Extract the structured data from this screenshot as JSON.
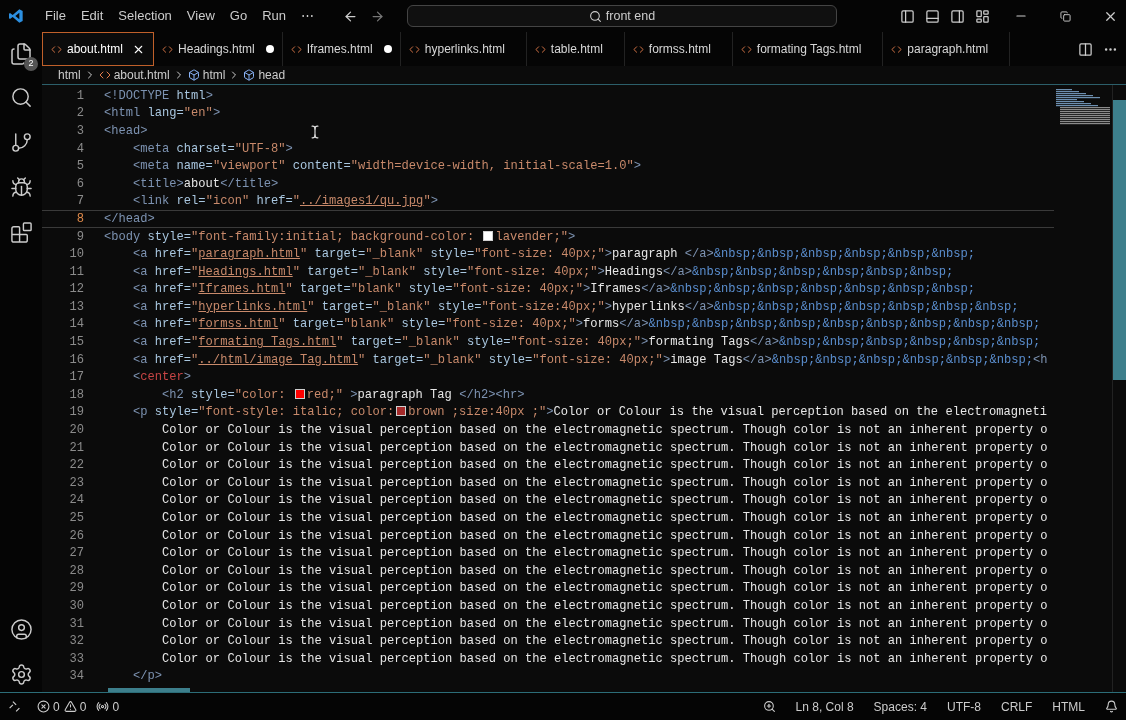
{
  "menu": [
    "File",
    "Edit",
    "Selection",
    "View",
    "Go",
    "Run",
    "⋯"
  ],
  "search": {
    "value": "front end"
  },
  "activity": {
    "explorer_badge": "2"
  },
  "tabs": [
    {
      "label": "about.html",
      "selected": true,
      "modified": false
    },
    {
      "label": "Headings.html",
      "selected": false,
      "modified": true
    },
    {
      "label": "Iframes.html",
      "selected": false,
      "modified": true
    },
    {
      "label": "hyperlinks.html",
      "selected": false,
      "modified": false
    },
    {
      "label": "table.html",
      "selected": false,
      "modified": false
    },
    {
      "label": "formss.html",
      "selected": false,
      "modified": false
    },
    {
      "label": "formating Tags.html",
      "selected": false,
      "modified": false
    },
    {
      "label": "paragraph.html",
      "selected": false,
      "modified": false
    }
  ],
  "breadcrumb": [
    {
      "label": "html",
      "kind": "folder"
    },
    {
      "label": "about.html",
      "kind": "file"
    },
    {
      "label": "html",
      "kind": "element"
    },
    {
      "label": "head",
      "kind": "element"
    }
  ],
  "lines": [
    {
      "n": "1",
      "active": false,
      "tokens": [
        {
          "kind": "tag",
          "t": "<!DOCTYPE"
        },
        {
          "kind": "attr",
          "t": " html"
        },
        {
          "kind": "tag",
          "t": ">"
        }
      ]
    },
    {
      "n": "2",
      "active": false,
      "tokens": [
        {
          "kind": "tag",
          "t": "<html"
        },
        {
          "kind": "attr",
          "t": " lang="
        },
        {
          "kind": "str",
          "t": "\"en\""
        },
        {
          "kind": "tag",
          "t": ">"
        }
      ]
    },
    {
      "n": "3",
      "active": false,
      "tokens": [
        {
          "kind": "tag",
          "t": "<head>"
        }
      ]
    },
    {
      "n": "4",
      "active": false,
      "tokens": [
        {
          "kind": "tag",
          "t": "    <meta"
        },
        {
          "kind": "attr",
          "t": " charset="
        },
        {
          "kind": "str",
          "t": "\"UTF-8\""
        },
        {
          "kind": "tag",
          "t": ">"
        }
      ]
    },
    {
      "n": "5",
      "active": false,
      "tokens": [
        {
          "kind": "tag",
          "t": "    <meta"
        },
        {
          "kind": "attr",
          "t": " name="
        },
        {
          "kind": "str",
          "t": "\"viewport\""
        },
        {
          "kind": "attr",
          "t": " content="
        },
        {
          "kind": "str",
          "t": "\"width=device-width, initial-scale=1.0\""
        },
        {
          "kind": "tag",
          "t": ">"
        }
      ]
    },
    {
      "n": "6",
      "active": false,
      "tokens": [
        {
          "kind": "tag",
          "t": "    <title>"
        },
        {
          "kind": "txt",
          "t": "about"
        },
        {
          "kind": "tag",
          "t": "</title>"
        }
      ]
    },
    {
      "n": "7",
      "active": false,
      "tokens": [
        {
          "kind": "tag",
          "t": "    <link"
        },
        {
          "kind": "attr",
          "t": " rel="
        },
        {
          "kind": "str",
          "t": "\"icon\""
        },
        {
          "kind": "attr",
          "t": " href="
        },
        {
          "kind": "str",
          "t": "\""
        },
        {
          "kind": "link",
          "t": "../images1/qu.jpg"
        },
        {
          "kind": "str",
          "t": "\""
        },
        {
          "kind": "tag",
          "t": ">"
        }
      ]
    },
    {
      "n": "8",
      "active": true,
      "tokens": [
        {
          "kind": "tag",
          "t": "</head>"
        }
      ]
    },
    {
      "n": "9",
      "active": false,
      "tokens": [
        {
          "kind": "tag",
          "t": "<body"
        },
        {
          "kind": "attr",
          "t": " style="
        },
        {
          "kind": "str",
          "t": "\"font-family:initial; background-color: "
        },
        {
          "kind": "swatch",
          "color": "#ffffff"
        },
        {
          "kind": "str",
          "t": "lavender;\""
        },
        {
          "kind": "tag",
          "t": ">"
        }
      ]
    },
    {
      "n": "10",
      "active": false,
      "tokens": [
        {
          "kind": "tag",
          "t": "    <a"
        },
        {
          "kind": "attr",
          "t": " href="
        },
        {
          "kind": "str",
          "t": "\""
        },
        {
          "kind": "link",
          "t": "paragraph.html"
        },
        {
          "kind": "str",
          "t": "\""
        },
        {
          "kind": "attr",
          "t": " target="
        },
        {
          "kind": "str",
          "t": "\"_blank\""
        },
        {
          "kind": "attr",
          "t": " style="
        },
        {
          "kind": "str",
          "t": "\"font-size: 40px;\""
        },
        {
          "kind": "tag",
          "t": ">"
        },
        {
          "kind": "txt",
          "t": "paragraph "
        },
        {
          "kind": "tag",
          "t": "</a>"
        },
        {
          "kind": "ent",
          "t": "&nbsp;&nbsp;&nbsp;&nbsp;&nbsp;&nbsp;"
        }
      ]
    },
    {
      "n": "11",
      "active": false,
      "tokens": [
        {
          "kind": "tag",
          "t": "    <a"
        },
        {
          "kind": "attr",
          "t": " href="
        },
        {
          "kind": "str",
          "t": "\""
        },
        {
          "kind": "link",
          "t": "Headings.html"
        },
        {
          "kind": "str",
          "t": "\""
        },
        {
          "kind": "attr",
          "t": " target="
        },
        {
          "kind": "str",
          "t": "\"_blank\""
        },
        {
          "kind": "attr",
          "t": " style="
        },
        {
          "kind": "str",
          "t": "\"font-size: 40px;\""
        },
        {
          "kind": "tag",
          "t": ">"
        },
        {
          "kind": "txt",
          "t": "Headings"
        },
        {
          "kind": "tag",
          "t": "</a>"
        },
        {
          "kind": "ent",
          "t": "&nbsp;&nbsp;&nbsp;&nbsp;&nbsp;&nbsp;"
        }
      ]
    },
    {
      "n": "12",
      "active": false,
      "tokens": [
        {
          "kind": "tag",
          "t": "    <a"
        },
        {
          "kind": "attr",
          "t": " href="
        },
        {
          "kind": "str",
          "t": "\""
        },
        {
          "kind": "link",
          "t": "Iframes.html"
        },
        {
          "kind": "str",
          "t": "\""
        },
        {
          "kind": "attr",
          "t": " target="
        },
        {
          "kind": "str",
          "t": "\"blank\""
        },
        {
          "kind": "attr",
          "t": " style="
        },
        {
          "kind": "str",
          "t": "\"font-size: 40px;\""
        },
        {
          "kind": "tag",
          "t": ">"
        },
        {
          "kind": "txt",
          "t": "Iframes"
        },
        {
          "kind": "tag",
          "t": "</a>"
        },
        {
          "kind": "ent",
          "t": "&nbsp;&nbsp;&nbsp;&nbsp;&nbsp;&nbsp;&nbsp;"
        }
      ]
    },
    {
      "n": "13",
      "active": false,
      "tokens": [
        {
          "kind": "tag",
          "t": "    <a"
        },
        {
          "kind": "attr",
          "t": " href="
        },
        {
          "kind": "str",
          "t": "\""
        },
        {
          "kind": "link",
          "t": "hyperlinks.html"
        },
        {
          "kind": "str",
          "t": "\""
        },
        {
          "kind": "attr",
          "t": " target="
        },
        {
          "kind": "str",
          "t": "\"_blank\""
        },
        {
          "kind": "attr",
          "t": " style="
        },
        {
          "kind": "str",
          "t": "\"font-size:40px;\""
        },
        {
          "kind": "tag",
          "t": ">"
        },
        {
          "kind": "txt",
          "t": "hyperlinks"
        },
        {
          "kind": "tag",
          "t": "</a>"
        },
        {
          "kind": "ent",
          "t": "&nbsp;&nbsp;&nbsp;&nbsp;&nbsp;&nbsp;&nbsp;"
        }
      ]
    },
    {
      "n": "14",
      "active": false,
      "tokens": [
        {
          "kind": "tag",
          "t": "    <a"
        },
        {
          "kind": "attr",
          "t": " href="
        },
        {
          "kind": "str",
          "t": "\""
        },
        {
          "kind": "link",
          "t": "formss.html"
        },
        {
          "kind": "str",
          "t": "\""
        },
        {
          "kind": "attr",
          "t": " target="
        },
        {
          "kind": "str",
          "t": "\"blank\""
        },
        {
          "kind": "attr",
          "t": " style="
        },
        {
          "kind": "str",
          "t": "\"font-size: 40px;\""
        },
        {
          "kind": "tag",
          "t": ">"
        },
        {
          "kind": "txt",
          "t": "forms"
        },
        {
          "kind": "tag",
          "t": "</a>"
        },
        {
          "kind": "ent",
          "t": "&nbsp;&nbsp;&nbsp;&nbsp;&nbsp;&nbsp;&nbsp;&nbsp;&nbsp;"
        }
      ]
    },
    {
      "n": "15",
      "active": false,
      "tokens": [
        {
          "kind": "tag",
          "t": "    <a"
        },
        {
          "kind": "attr",
          "t": " href="
        },
        {
          "kind": "str",
          "t": "\""
        },
        {
          "kind": "link",
          "t": "formating Tags.html"
        },
        {
          "kind": "str",
          "t": "\""
        },
        {
          "kind": "attr",
          "t": " target="
        },
        {
          "kind": "str",
          "t": "\"_blank\""
        },
        {
          "kind": "attr",
          "t": " style="
        },
        {
          "kind": "str",
          "t": "\"font-size: 40px;\""
        },
        {
          "kind": "tag",
          "t": ">"
        },
        {
          "kind": "txt",
          "t": "formating Tags"
        },
        {
          "kind": "tag",
          "t": "</a>"
        },
        {
          "kind": "ent",
          "t": "&nbsp;&nbsp;&nbsp;&nbsp;&nbsp;&nbsp;"
        }
      ]
    },
    {
      "n": "16",
      "active": false,
      "tokens": [
        {
          "kind": "tag",
          "t": "    <a"
        },
        {
          "kind": "attr",
          "t": " href="
        },
        {
          "kind": "str",
          "t": "\""
        },
        {
          "kind": "link",
          "t": "../html/image Tag.html"
        },
        {
          "kind": "str",
          "t": "\""
        },
        {
          "kind": "attr",
          "t": " target="
        },
        {
          "kind": "str",
          "t": "\"_blank\""
        },
        {
          "kind": "attr",
          "t": " style="
        },
        {
          "kind": "str",
          "t": "\"font-size: 40px;\""
        },
        {
          "kind": "tag",
          "t": ">"
        },
        {
          "kind": "txt",
          "t": "image Tags"
        },
        {
          "kind": "tag",
          "t": "</a>"
        },
        {
          "kind": "ent",
          "t": "&nbsp;&nbsp;&nbsp;&nbsp;&nbsp;&nbsp;"
        },
        {
          "kind": "tag",
          "t": "<h"
        }
      ]
    },
    {
      "n": "17",
      "active": false,
      "tokens": [
        {
          "kind": "tag",
          "t": "    <"
        },
        {
          "kind": "deprecated",
          "t": "center"
        },
        {
          "kind": "tag",
          "t": ">"
        }
      ]
    },
    {
      "n": "18",
      "active": false,
      "tokens": [
        {
          "kind": "tag",
          "t": "        <h2"
        },
        {
          "kind": "attr",
          "t": " style="
        },
        {
          "kind": "str",
          "t": "\"color: "
        },
        {
          "kind": "swatch",
          "color": "#ff0000"
        },
        {
          "kind": "str",
          "t": "red;\""
        },
        {
          "kind": "tag",
          "t": " >"
        },
        {
          "kind": "txt",
          "t": "paragraph Tag "
        },
        {
          "kind": "tag",
          "t": "</h2><hr>"
        }
      ]
    },
    {
      "n": "19",
      "active": false,
      "tokens": [
        {
          "kind": "tag",
          "t": "    <p"
        },
        {
          "kind": "attr",
          "t": " style="
        },
        {
          "kind": "str",
          "t": "\"font-style: italic; color:"
        },
        {
          "kind": "swatch",
          "color": "#a52a2a"
        },
        {
          "kind": "str",
          "t": "brown ;size:40px ;\""
        },
        {
          "kind": "tag",
          "t": ">"
        },
        {
          "kind": "txt",
          "t": "Color or Colour is the visual perception based on the electromagneti"
        }
      ]
    },
    {
      "n": "20",
      "active": false,
      "tokens": [
        {
          "kind": "txt",
          "t": "        Color or Colour is the visual perception based on the electromagnetic spectrum. Though color is not an inherent property o"
        }
      ]
    },
    {
      "n": "21",
      "active": false,
      "tokens": [
        {
          "kind": "txt",
          "t": "        Color or Colour is the visual perception based on the electromagnetic spectrum. Though color is not an inherent property o"
        }
      ]
    },
    {
      "n": "22",
      "active": false,
      "tokens": [
        {
          "kind": "txt",
          "t": "        Color or Colour is the visual perception based on the electromagnetic spectrum. Though color is not an inherent property o"
        }
      ]
    },
    {
      "n": "23",
      "active": false,
      "tokens": [
        {
          "kind": "txt",
          "t": "        Color or Colour is the visual perception based on the electromagnetic spectrum. Though color is not an inherent property o"
        }
      ]
    },
    {
      "n": "24",
      "active": false,
      "tokens": [
        {
          "kind": "txt",
          "t": "        Color or Colour is the visual perception based on the electromagnetic spectrum. Though color is not an inherent property o"
        }
      ]
    },
    {
      "n": "25",
      "active": false,
      "tokens": [
        {
          "kind": "txt",
          "t": "        Color or Colour is the visual perception based on the electromagnetic spectrum. Though color is not an inherent property o"
        }
      ]
    },
    {
      "n": "26",
      "active": false,
      "tokens": [
        {
          "kind": "txt",
          "t": "        Color or Colour is the visual perception based on the electromagnetic spectrum. Though color is not an inherent property o"
        }
      ]
    },
    {
      "n": "27",
      "active": false,
      "tokens": [
        {
          "kind": "txt",
          "t": "        Color or Colour is the visual perception based on the electromagnetic spectrum. Though color is not an inherent property o"
        }
      ]
    },
    {
      "n": "28",
      "active": false,
      "tokens": [
        {
          "kind": "txt",
          "t": "        Color or Colour is the visual perception based on the electromagnetic spectrum. Though color is not an inherent property o"
        }
      ]
    },
    {
      "n": "29",
      "active": false,
      "tokens": [
        {
          "kind": "txt",
          "t": "        Color or Colour is the visual perception based on the electromagnetic spectrum. Though color is not an inherent property o"
        }
      ]
    },
    {
      "n": "30",
      "active": false,
      "tokens": [
        {
          "kind": "txt",
          "t": "        Color or Colour is the visual perception based on the electromagnetic spectrum. Though color is not an inherent property o"
        }
      ]
    },
    {
      "n": "31",
      "active": false,
      "tokens": [
        {
          "kind": "txt",
          "t": "        Color or Colour is the visual perception based on the electromagnetic spectrum. Though color is not an inherent property o"
        }
      ]
    },
    {
      "n": "32",
      "active": false,
      "tokens": [
        {
          "kind": "txt",
          "t": "        Color or Colour is the visual perception based on the electromagnetic spectrum. Though color is not an inherent property o"
        }
      ]
    },
    {
      "n": "33",
      "active": false,
      "tokens": [
        {
          "kind": "txt",
          "t": "        Color or Colour is the visual perception based on the electromagnetic spectrum. Though color is not an inherent property o"
        }
      ]
    },
    {
      "n": "34",
      "active": false,
      "tokens": [
        {
          "kind": "tag",
          "t": "    </p>"
        }
      ]
    }
  ],
  "status": {
    "errors": "0",
    "warnings": "0",
    "ports": "0",
    "position": "Ln 8, Col 8",
    "indent": "Spaces: 4",
    "encoding": "UTF-8",
    "eol": "CRLF",
    "language": "HTML"
  }
}
